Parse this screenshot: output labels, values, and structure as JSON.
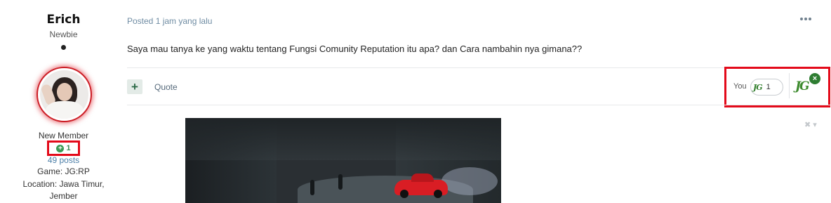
{
  "author": {
    "name": "Erich",
    "rank": "Newbie",
    "member_group": "New Member",
    "reputation": "1",
    "posts": "49 posts",
    "game": "Game: JG:RP",
    "location_line1": "Location: Jawa Timur,",
    "location_line2": "Jember"
  },
  "post": {
    "meta": "Posted 1 jam yang lalu",
    "content": "Saya mau tanya ke yang waktu tentang Fungsi Comunity Reputation itu apa? dan Cara nambahin nya gimana??",
    "quote_label": "Quote",
    "plus_label": "+"
  },
  "reactions": {
    "you_label": "You",
    "reaction_name": "JG",
    "count": "1",
    "remove_symbol": "×"
  },
  "icons": {
    "more": "more-options-icon",
    "close": "close-icon"
  },
  "colors": {
    "highlight": "#e30a1a",
    "reputation_green": "#3b9b55",
    "link_blue": "#4c7fa8"
  }
}
